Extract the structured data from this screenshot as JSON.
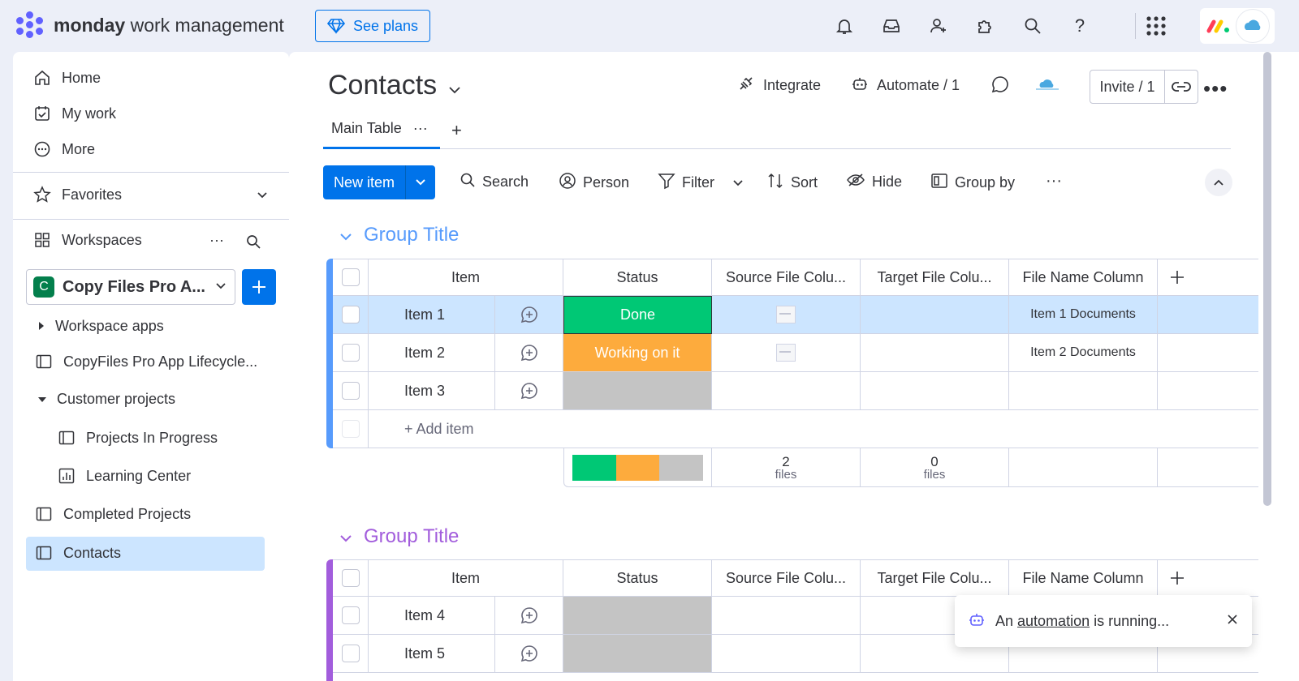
{
  "topbar": {
    "brand_bold": "monday",
    "brand_rest": " work management",
    "see_plans": "See plans",
    "colors": {
      "accent": "#0073ea",
      "bg": "#eceff8"
    }
  },
  "sidebar": {
    "nav": [
      "Home",
      "My work",
      "More"
    ],
    "favorites": "Favorites",
    "workspaces": "Workspaces",
    "workspace_badge": "C",
    "workspace_name": "Copy Files Pro A...",
    "items": [
      {
        "label": "Workspace apps"
      },
      {
        "label": "CopyFiles Pro App Lifecycle..."
      },
      {
        "label": "Customer projects"
      },
      {
        "label": "Projects In Progress"
      },
      {
        "label": "Learning Center"
      },
      {
        "label": "Completed Projects"
      },
      {
        "label": "Contacts"
      }
    ]
  },
  "board": {
    "title": "Contacts",
    "integrate": "Integrate",
    "automate": "Automate / 1",
    "invite": "Invite / 1",
    "tab_main": "Main Table",
    "tab_more": "···",
    "tab_add": "+"
  },
  "toolbar": {
    "new_item": "New item",
    "search": "Search",
    "person": "Person",
    "filter": "Filter",
    "sort": "Sort",
    "hide": "Hide",
    "group_by": "Group by",
    "more": "···"
  },
  "columns": [
    "Item",
    "Status",
    "Source File Colu...",
    "Target File Colu...",
    "File Name Column"
  ],
  "group1": {
    "title": "Group Title",
    "color": "#579bfc",
    "rows": [
      {
        "item": "Item 1",
        "status": "Done",
        "status_color": "#00c875",
        "file_name": "Item 1 Documents"
      },
      {
        "item": "Item 2",
        "status": "Working on it",
        "status_color": "#fdab3d",
        "file_name": "Item 2 Documents"
      },
      {
        "item": "Item 3",
        "status": "",
        "status_color": "#c4c4c4",
        "file_name": ""
      }
    ],
    "add_item": "+ Add item",
    "summary": {
      "source_count": "2",
      "source_unit": "files",
      "target_count": "0",
      "target_unit": "files"
    }
  },
  "group2": {
    "title": "Group Title",
    "color": "#a25ddc",
    "rows": [
      {
        "item": "Item 4",
        "status": "",
        "status_color": "#c4c4c4"
      },
      {
        "item": "Item 5",
        "status": "",
        "status_color": "#c4c4c4"
      }
    ]
  },
  "toast": {
    "prefix": "An ",
    "link": "automation",
    "suffix": " is running..."
  }
}
